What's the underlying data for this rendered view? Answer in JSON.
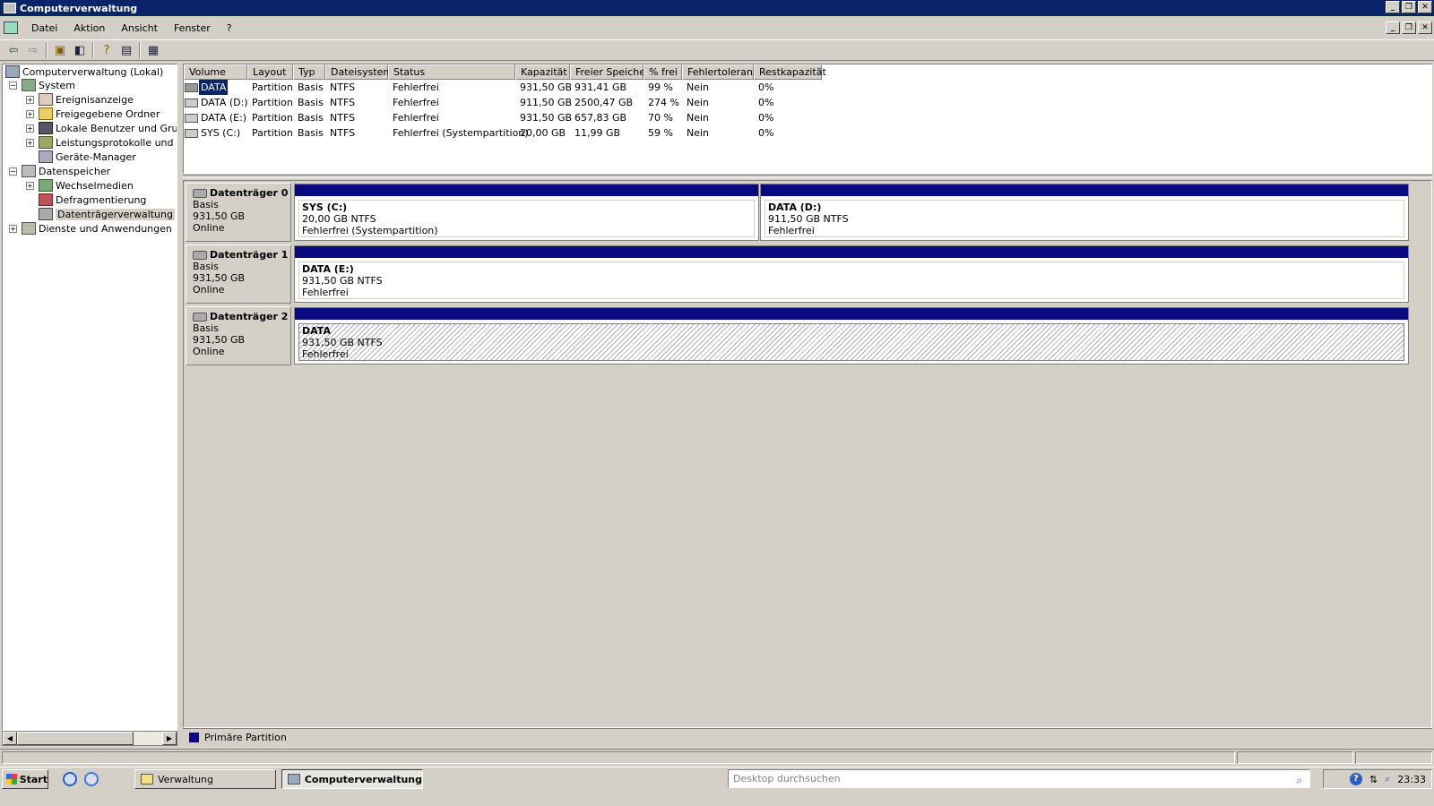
{
  "window": {
    "title": "Computerverwaltung"
  },
  "menu": [
    "Datei",
    "Aktion",
    "Ansicht",
    "Fenster",
    "?"
  ],
  "toolbar_icons": [
    "back-icon",
    "forward-icon",
    "up-folder-icon",
    "show-hide-tree-icon",
    "help-icon",
    "properties-icon",
    "export-icon"
  ],
  "tree": {
    "root": "Computerverwaltung (Lokal)",
    "system": "System",
    "ereignis": "Ereignisanzeige",
    "freigegeben": "Freigegebene Ordner",
    "lokale": "Lokale Benutzer und Gruppen",
    "leistung": "Leistungsprotokolle und Warnungen",
    "geraete": "Geräte-Manager",
    "daten": "Datenspeicher",
    "wechsel": "Wechselmedien",
    "defrag": "Defragmentierung",
    "datenver": "Datenträgerverwaltung",
    "dienste": "Dienste und Anwendungen"
  },
  "columns": {
    "volume": "Volume",
    "layout": "Layout",
    "typ": "Typ",
    "dateisystem": "Dateisystem",
    "status": "Status",
    "kapazitaet": "Kapazität",
    "frei": "Freier Speicher",
    "prozent": "% frei",
    "fehlertoleranz": "Fehlertoleranz",
    "rest": "Restkapazität"
  },
  "volumes": [
    {
      "volume": "DATA",
      "layout": "Partition",
      "typ": "Basis",
      "fs": "NTFS",
      "status": "Fehlerfrei",
      "kap": "931,50 GB",
      "frei": "931,41 GB",
      "pct": "99 %",
      "ft": "Nein",
      "rest": "0%"
    },
    {
      "volume": "DATA (D:)",
      "layout": "Partition",
      "typ": "Basis",
      "fs": "NTFS",
      "status": "Fehlerfrei",
      "kap": "911,50 GB",
      "frei": "2500,47 GB",
      "pct": "274 %",
      "ft": "Nein",
      "rest": "0%"
    },
    {
      "volume": "DATA (E:)",
      "layout": "Partition",
      "typ": "Basis",
      "fs": "NTFS",
      "status": "Fehlerfrei",
      "kap": "931,50 GB",
      "frei": "657,83 GB",
      "pct": "70 %",
      "ft": "Nein",
      "rest": "0%"
    },
    {
      "volume": "SYS (C:)",
      "layout": "Partition",
      "typ": "Basis",
      "fs": "NTFS",
      "status": "Fehlerfrei (Systempartition)",
      "kap": "20,00 GB",
      "frei": "11,99 GB",
      "pct": "59 %",
      "ft": "Nein",
      "rest": "0%"
    }
  ],
  "disks": [
    {
      "name": "Datenträger 0",
      "type": "Basis",
      "size": "931,50 GB",
      "state": "Online",
      "parts": [
        {
          "name": "SYS  (C:)",
          "fs": "20,00 GB NTFS",
          "status": "Fehlerfrei (Systempartition)"
        },
        {
          "name": "DATA  (D:)",
          "fs": "911,50 GB NTFS",
          "status": "Fehlerfrei"
        }
      ]
    },
    {
      "name": "Datenträger 1",
      "type": "Basis",
      "size": "931,50 GB",
      "state": "Online",
      "parts": [
        {
          "name": "DATA  (E:)",
          "fs": "931,50 GB NTFS",
          "status": "Fehlerfrei"
        }
      ]
    },
    {
      "name": "Datenträger 2",
      "type": "Basis",
      "size": "931,50 GB",
      "state": "Online",
      "parts": [
        {
          "name": "DATA",
          "fs": "931,50 GB NTFS",
          "status": "Fehlerfrei"
        }
      ]
    }
  ],
  "legend": {
    "label": "Primäre Partition",
    "color": "#0a0a80"
  },
  "taskbar": {
    "start": "Start",
    "tasks": [
      "Verwaltung",
      "Computerverwaltung"
    ],
    "search_placeholder": "Desktop durchsuchen",
    "clock": "23:33"
  },
  "colors": {
    "titlebar": "#0a246a",
    "partition_bar": "#0a0a80",
    "face": "#d4d0c8"
  }
}
